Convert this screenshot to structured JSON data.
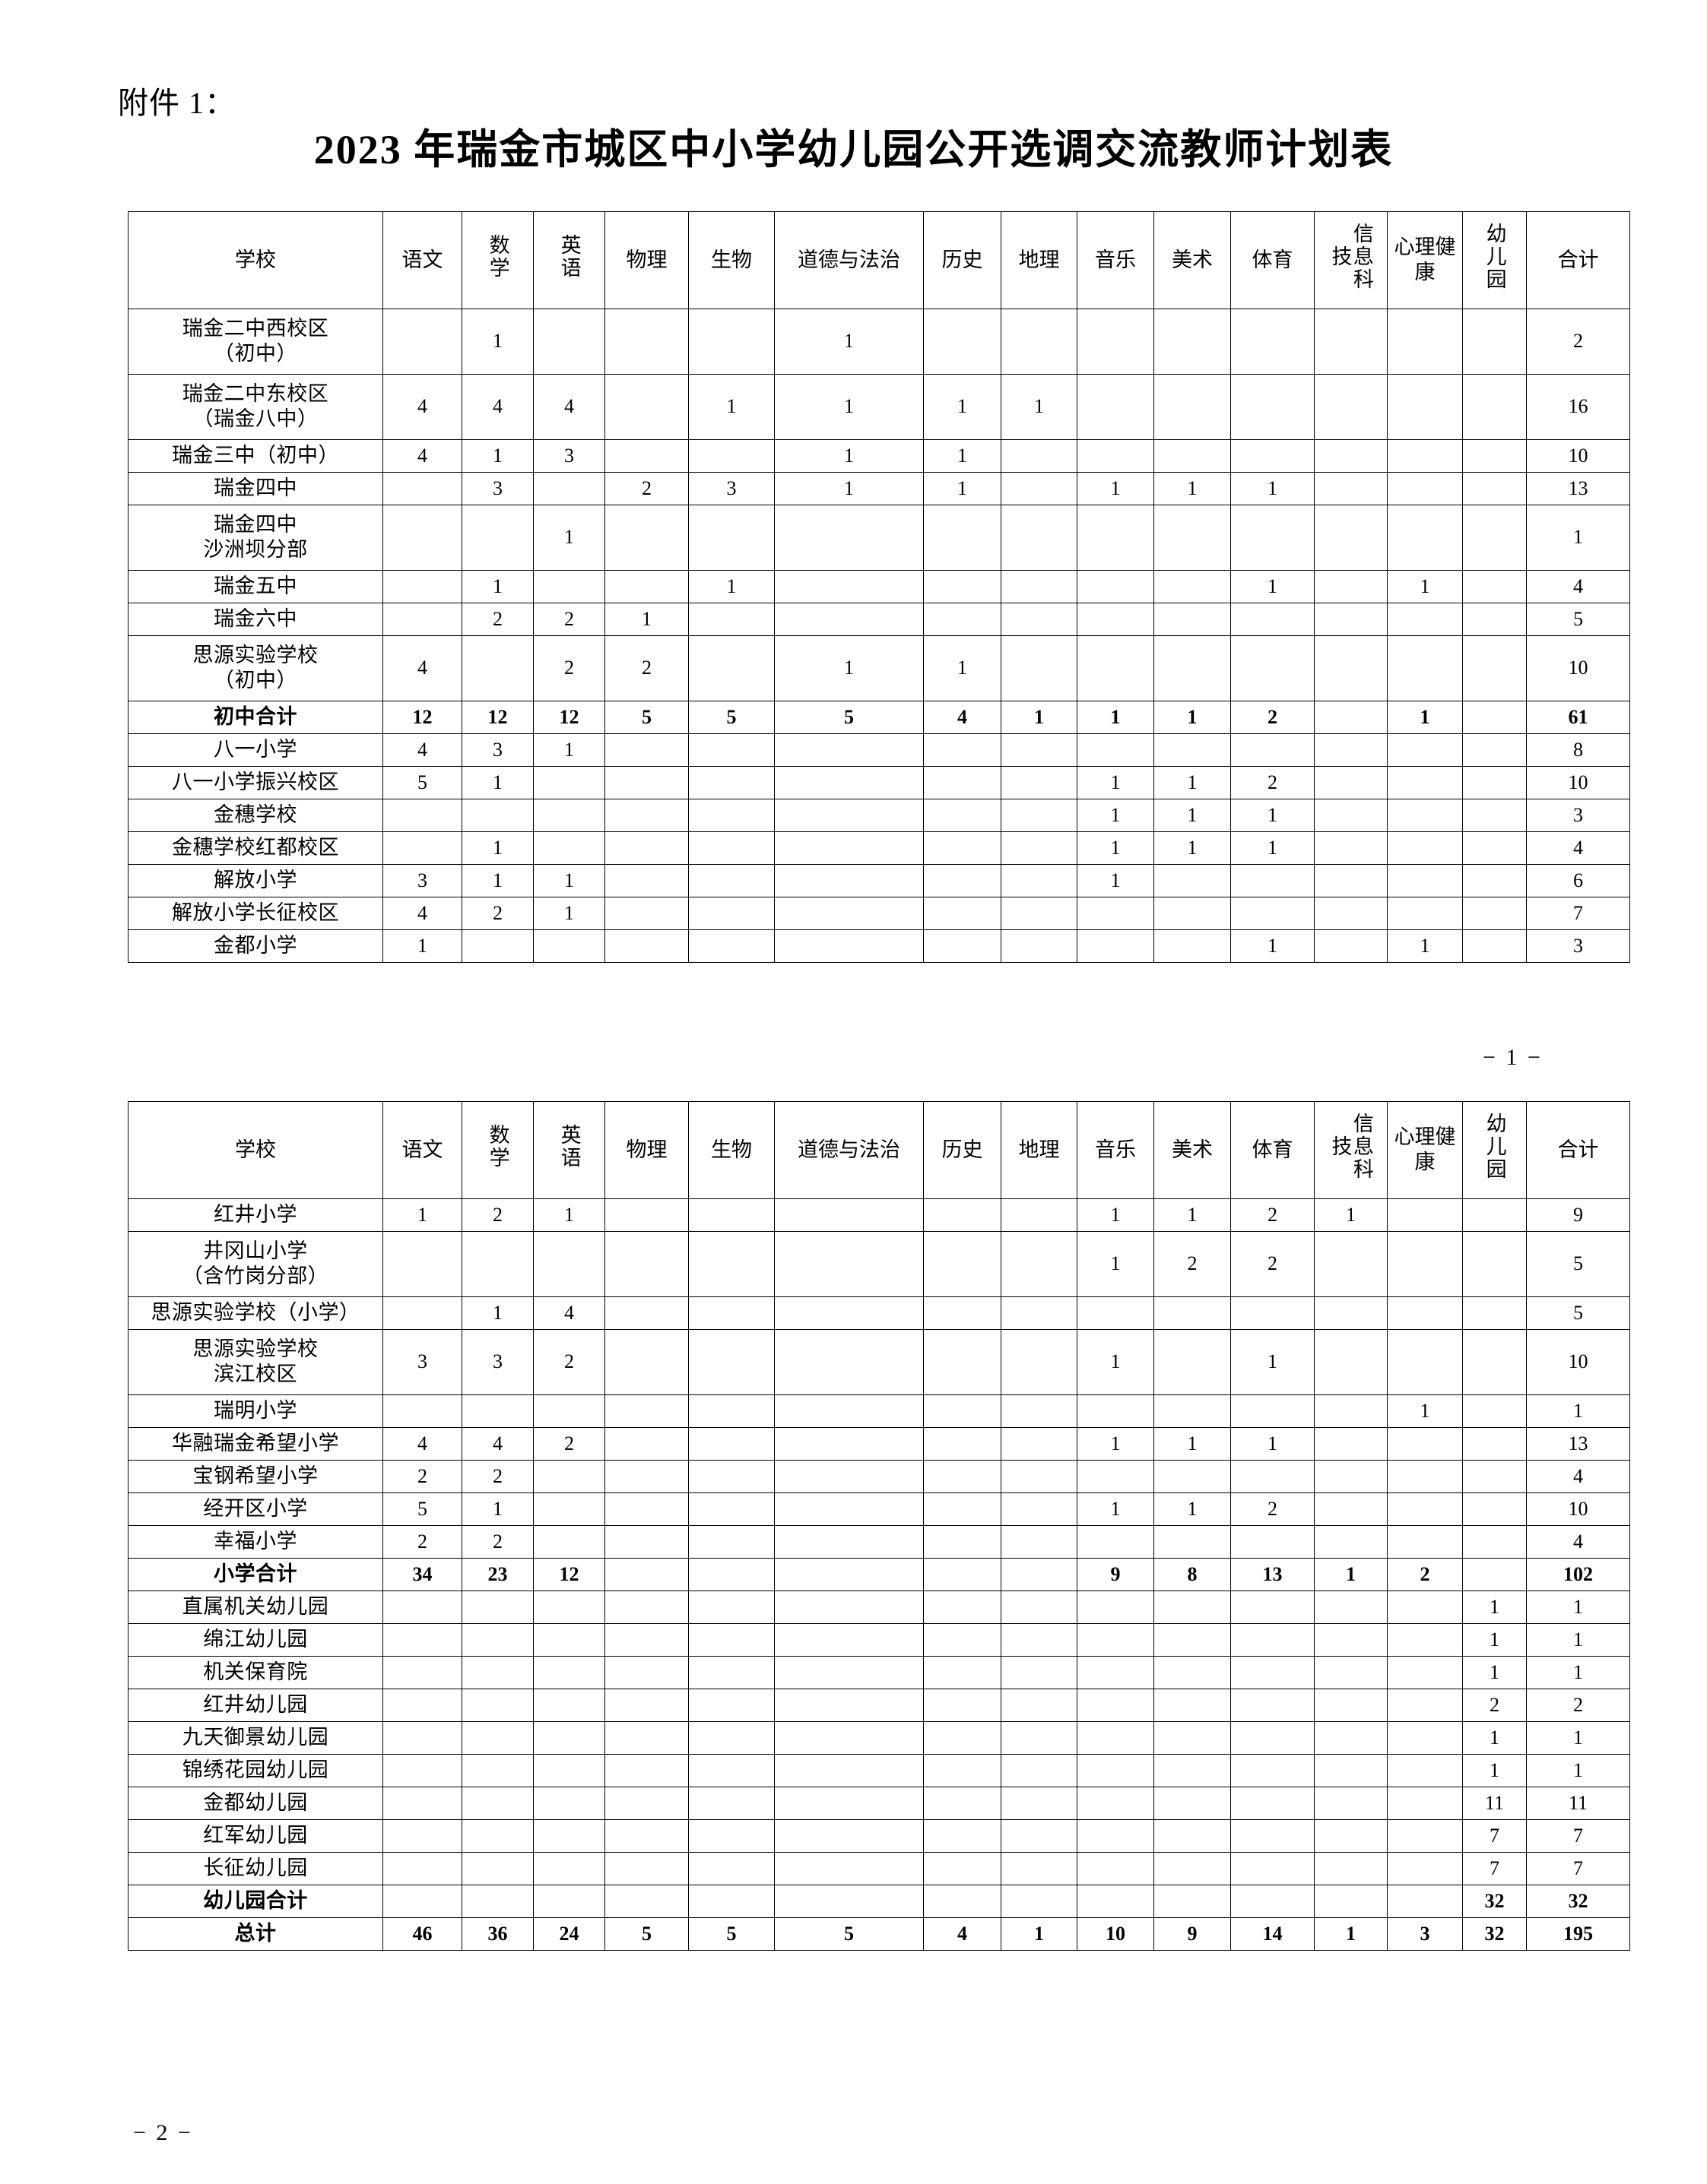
{
  "document": {
    "attachment_label": "附件 1：",
    "title": "2023 年瑞金市城区中小学幼儿园公开选调交流教师计划表",
    "page_number_1": "− 1 −",
    "page_number_2": "− 2 −"
  },
  "columns": [
    {
      "key": "school",
      "label": "学校",
      "vertical": false
    },
    {
      "key": "chinese",
      "label": "语文",
      "vertical": false
    },
    {
      "key": "math",
      "label": "数学",
      "vertical": true
    },
    {
      "key": "english",
      "label": "英语",
      "vertical": true
    },
    {
      "key": "physics",
      "label": "物理",
      "vertical": false
    },
    {
      "key": "biology",
      "label": "生物",
      "vertical": false
    },
    {
      "key": "morality_law",
      "label": "道德与法治",
      "vertical": false
    },
    {
      "key": "history",
      "label": "历史",
      "vertical": false
    },
    {
      "key": "geography",
      "label": "地理",
      "vertical": false
    },
    {
      "key": "music",
      "label": "音乐",
      "vertical": false
    },
    {
      "key": "art",
      "label": "美术",
      "vertical": false
    },
    {
      "key": "pe",
      "label": "体育",
      "vertical": false
    },
    {
      "key": "info_tech",
      "label": "信息科技",
      "vertical": true
    },
    {
      "key": "mental_health",
      "label": "心理健康",
      "vertical": false
    },
    {
      "key": "kindergarten",
      "label": "幼儿园",
      "vertical": true
    },
    {
      "key": "total",
      "label": "合计",
      "vertical": false
    }
  ],
  "table1": {
    "rows": [
      {
        "school": "瑞金二中西校区\n（初中）",
        "values": [
          "",
          "1",
          "",
          "",
          "",
          "1",
          "",
          "",
          "",
          "",
          "",
          "",
          "",
          "",
          "2"
        ],
        "bold": false
      },
      {
        "school": "瑞金二中东校区\n（瑞金八中）",
        "values": [
          "4",
          "4",
          "4",
          "",
          "1",
          "1",
          "1",
          "1",
          "",
          "",
          "",
          "",
          "",
          "",
          "16"
        ],
        "bold": false
      },
      {
        "school": "瑞金三中（初中）",
        "values": [
          "4",
          "1",
          "3",
          "",
          "",
          "1",
          "1",
          "",
          "",
          "",
          "",
          "",
          "",
          "",
          "10"
        ],
        "bold": false
      },
      {
        "school": "瑞金四中",
        "values": [
          "",
          "3",
          "",
          "2",
          "3",
          "1",
          "1",
          "",
          "1",
          "1",
          "1",
          "",
          "",
          "",
          "13"
        ],
        "bold": false
      },
      {
        "school": "瑞金四中\n沙洲坝分部",
        "values": [
          "",
          "",
          "1",
          "",
          "",
          "",
          "",
          "",
          "",
          "",
          "",
          "",
          "",
          "",
          "1"
        ],
        "bold": false
      },
      {
        "school": "瑞金五中",
        "values": [
          "",
          "1",
          "",
          "",
          "1",
          "",
          "",
          "",
          "",
          "",
          "1",
          "",
          "1",
          "",
          "4"
        ],
        "bold": false
      },
      {
        "school": "瑞金六中",
        "values": [
          "",
          "2",
          "2",
          "1",
          "",
          "",
          "",
          "",
          "",
          "",
          "",
          "",
          "",
          "",
          "5"
        ],
        "bold": false
      },
      {
        "school": "思源实验学校\n（初中）",
        "values": [
          "4",
          "",
          "2",
          "2",
          "",
          "1",
          "1",
          "",
          "",
          "",
          "",
          "",
          "",
          "",
          "10"
        ],
        "bold": false
      },
      {
        "school": "初中合计",
        "values": [
          "12",
          "12",
          "12",
          "5",
          "5",
          "5",
          "4",
          "1",
          "1",
          "1",
          "2",
          "",
          "1",
          "",
          "61"
        ],
        "bold": true
      },
      {
        "school": "八一小学",
        "values": [
          "4",
          "3",
          "1",
          "",
          "",
          "",
          "",
          "",
          "",
          "",
          "",
          "",
          "",
          "",
          "8"
        ],
        "bold": false
      },
      {
        "school": "八一小学振兴校区",
        "values": [
          "5",
          "1",
          "",
          "",
          "",
          "",
          "",
          "",
          "1",
          "1",
          "2",
          "",
          "",
          "",
          "10"
        ],
        "bold": false
      },
      {
        "school": "金穗学校",
        "values": [
          "",
          "",
          "",
          "",
          "",
          "",
          "",
          "",
          "1",
          "1",
          "1",
          "",
          "",
          "",
          "3"
        ],
        "bold": false
      },
      {
        "school": "金穗学校红都校区",
        "values": [
          "",
          "1",
          "",
          "",
          "",
          "",
          "",
          "",
          "1",
          "1",
          "1",
          "",
          "",
          "",
          "4"
        ],
        "bold": false
      },
      {
        "school": "解放小学",
        "values": [
          "3",
          "1",
          "1",
          "",
          "",
          "",
          "",
          "",
          "1",
          "",
          "",
          "",
          "",
          "",
          "6"
        ],
        "bold": false
      },
      {
        "school": "解放小学长征校区",
        "values": [
          "4",
          "2",
          "1",
          "",
          "",
          "",
          "",
          "",
          "",
          "",
          "",
          "",
          "",
          "",
          "7"
        ],
        "bold": false
      },
      {
        "school": "金都小学",
        "values": [
          "1",
          "",
          "",
          "",
          "",
          "",
          "",
          "",
          "",
          "",
          "1",
          "",
          "1",
          "",
          "3"
        ],
        "bold": false
      }
    ]
  },
  "table2": {
    "rows": [
      {
        "school": "红井小学",
        "values": [
          "1",
          "2",
          "1",
          "",
          "",
          "",
          "",
          "",
          "1",
          "1",
          "2",
          "1",
          "",
          "",
          "9"
        ],
        "bold": false
      },
      {
        "school": "井冈山小学\n（含竹岗分部）",
        "values": [
          "",
          "",
          "",
          "",
          "",
          "",
          "",
          "",
          "1",
          "2",
          "2",
          "",
          "",
          "",
          "5"
        ],
        "bold": false
      },
      {
        "school": "思源实验学校（小学）",
        "values": [
          "",
          "1",
          "4",
          "",
          "",
          "",
          "",
          "",
          "",
          "",
          "",
          "",
          "",
          "",
          "5"
        ],
        "bold": false
      },
      {
        "school": "思源实验学校\n滨江校区",
        "values": [
          "3",
          "3",
          "2",
          "",
          "",
          "",
          "",
          "",
          "1",
          "",
          "1",
          "",
          "",
          "",
          "10"
        ],
        "bold": false
      },
      {
        "school": "瑞明小学",
        "values": [
          "",
          "",
          "",
          "",
          "",
          "",
          "",
          "",
          "",
          "",
          "",
          "",
          "1",
          "",
          "1"
        ],
        "bold": false
      },
      {
        "school": "华融瑞金希望小学",
        "values": [
          "4",
          "4",
          "2",
          "",
          "",
          "",
          "",
          "",
          "1",
          "1",
          "1",
          "",
          "",
          "",
          "13"
        ],
        "bold": false
      },
      {
        "school": "宝钢希望小学",
        "values": [
          "2",
          "2",
          "",
          "",
          "",
          "",
          "",
          "",
          "",
          "",
          "",
          "",
          "",
          "",
          "4"
        ],
        "bold": false
      },
      {
        "school": "经开区小学",
        "values": [
          "5",
          "1",
          "",
          "",
          "",
          "",
          "",
          "",
          "1",
          "1",
          "2",
          "",
          "",
          "",
          "10"
        ],
        "bold": false
      },
      {
        "school": "幸福小学",
        "values": [
          "2",
          "2",
          "",
          "",
          "",
          "",
          "",
          "",
          "",
          "",
          "",
          "",
          "",
          "",
          "4"
        ],
        "bold": false
      },
      {
        "school": "小学合计",
        "values": [
          "34",
          "23",
          "12",
          "",
          "",
          "",
          "",
          "",
          "9",
          "8",
          "13",
          "1",
          "2",
          "",
          "102"
        ],
        "bold": true
      },
      {
        "school": "直属机关幼儿园",
        "values": [
          "",
          "",
          "",
          "",
          "",
          "",
          "",
          "",
          "",
          "",
          "",
          "",
          "",
          "1",
          "1"
        ],
        "bold": false
      },
      {
        "school": "绵江幼儿园",
        "values": [
          "",
          "",
          "",
          "",
          "",
          "",
          "",
          "",
          "",
          "",
          "",
          "",
          "",
          "1",
          "1"
        ],
        "bold": false
      },
      {
        "school": "机关保育院",
        "values": [
          "",
          "",
          "",
          "",
          "",
          "",
          "",
          "",
          "",
          "",
          "",
          "",
          "",
          "1",
          "1"
        ],
        "bold": false
      },
      {
        "school": "红井幼儿园",
        "values": [
          "",
          "",
          "",
          "",
          "",
          "",
          "",
          "",
          "",
          "",
          "",
          "",
          "",
          "2",
          "2"
        ],
        "bold": false
      },
      {
        "school": "九天御景幼儿园",
        "values": [
          "",
          "",
          "",
          "",
          "",
          "",
          "",
          "",
          "",
          "",
          "",
          "",
          "",
          "1",
          "1"
        ],
        "bold": false
      },
      {
        "school": "锦绣花园幼儿园",
        "values": [
          "",
          "",
          "",
          "",
          "",
          "",
          "",
          "",
          "",
          "",
          "",
          "",
          "",
          "1",
          "1"
        ],
        "bold": false
      },
      {
        "school": "金都幼儿园",
        "values": [
          "",
          "",
          "",
          "",
          "",
          "",
          "",
          "",
          "",
          "",
          "",
          "",
          "",
          "11",
          "11"
        ],
        "bold": false
      },
      {
        "school": "红军幼儿园",
        "values": [
          "",
          "",
          "",
          "",
          "",
          "",
          "",
          "",
          "",
          "",
          "",
          "",
          "",
          "7",
          "7"
        ],
        "bold": false
      },
      {
        "school": "长征幼儿园",
        "values": [
          "",
          "",
          "",
          "",
          "",
          "",
          "",
          "",
          "",
          "",
          "",
          "",
          "",
          "7",
          "7"
        ],
        "bold": false
      },
      {
        "school": "幼儿园合计",
        "values": [
          "",
          "",
          "",
          "",
          "",
          "",
          "",
          "",
          "",
          "",
          "",
          "",
          "",
          "32",
          "32"
        ],
        "bold": true
      },
      {
        "school": "总计",
        "values": [
          "46",
          "36",
          "24",
          "5",
          "5",
          "5",
          "4",
          "1",
          "10",
          "9",
          "14",
          "1",
          "3",
          "32",
          "195"
        ],
        "bold": true
      }
    ]
  }
}
